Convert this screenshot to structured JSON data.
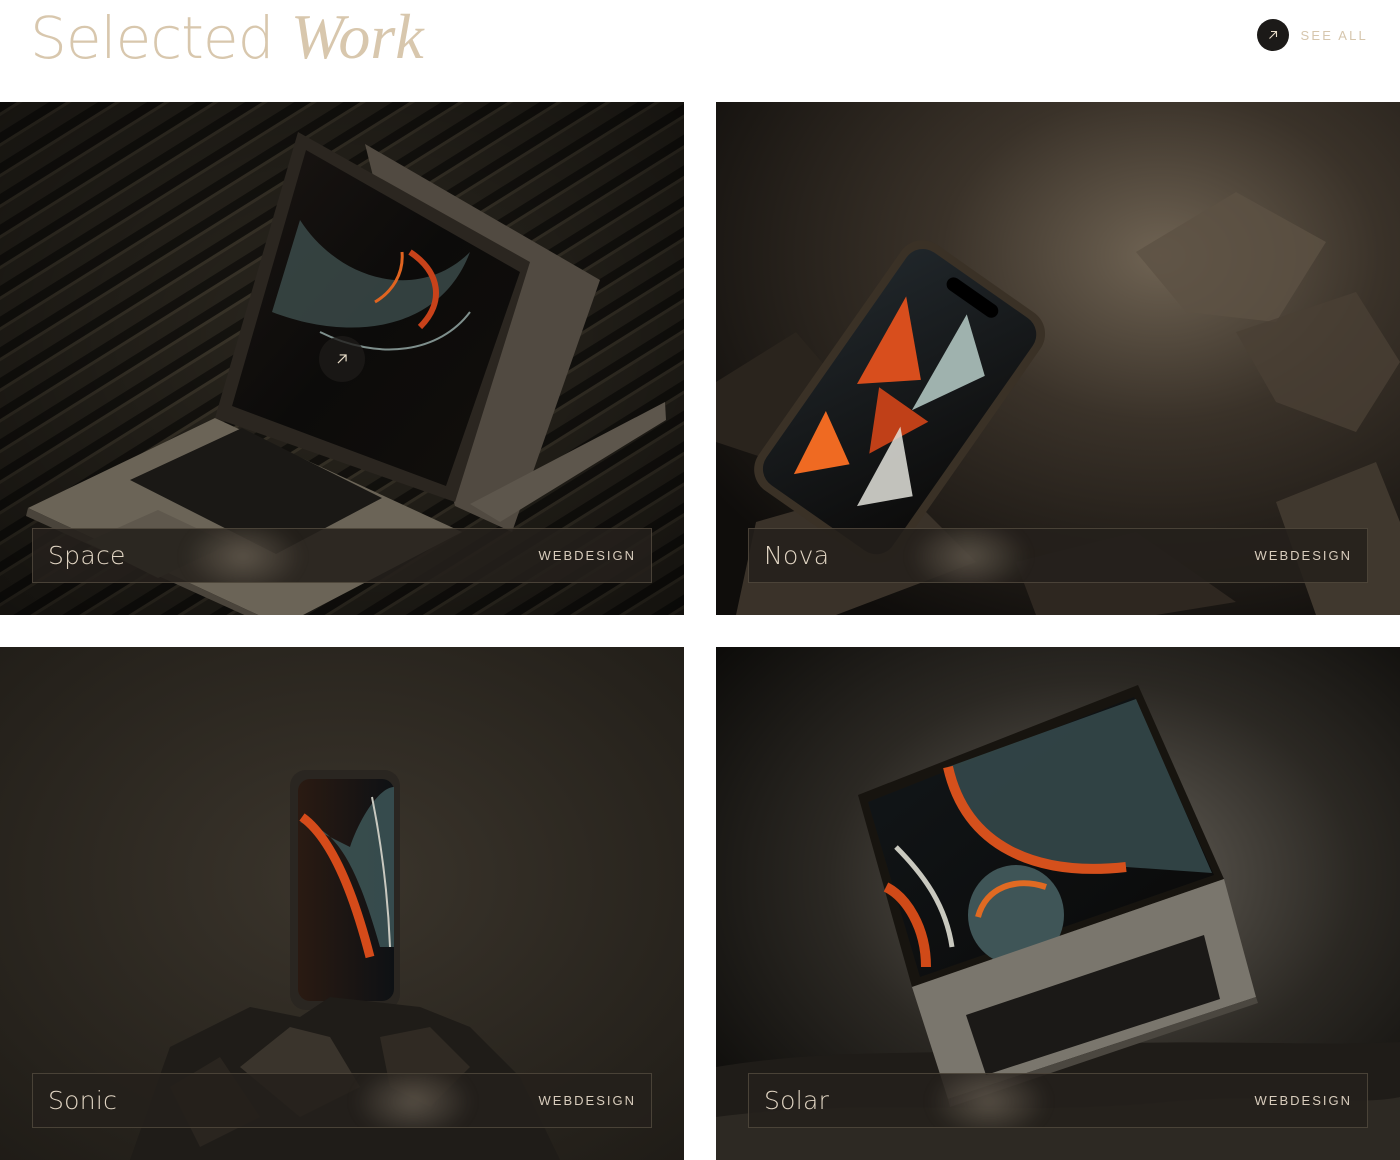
{
  "header": {
    "title_plain": "Selected",
    "title_accent": "Work",
    "see_all_label": "SEE ALL",
    "see_all_icon": "arrow-up-right-icon"
  },
  "colors": {
    "title": "#d8c7ad",
    "background": "#ffffff",
    "card_dark": "#1d1a16",
    "accent_orange": "#c2461c"
  },
  "projects": [
    {
      "name": "Space",
      "category": "WEBDESIGN"
    },
    {
      "name": "Nova",
      "category": "WEBDESIGN"
    },
    {
      "name": "Sonic",
      "category": "WEBDESIGN"
    },
    {
      "name": "Solar",
      "category": "WEBDESIGN"
    }
  ]
}
